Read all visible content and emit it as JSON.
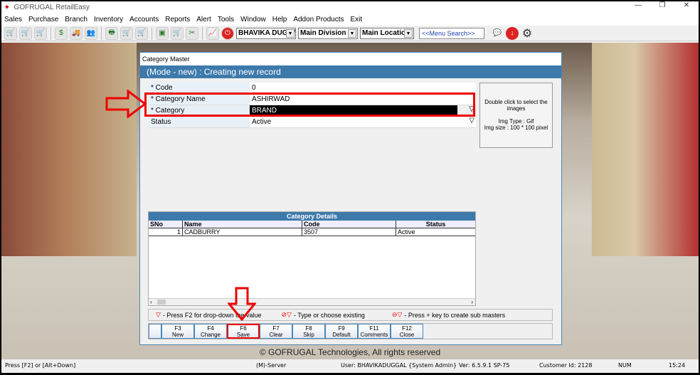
{
  "app": {
    "title": "GOFRUGAL RetailEasy"
  },
  "menu": [
    "Sales",
    "Purchase",
    "Branch",
    "Inventory",
    "Accounts",
    "Reports",
    "Alert",
    "Tools",
    "Window",
    "Help",
    "Addon Products",
    "Exit"
  ],
  "toolbar": {
    "user_select": "BHAVIKA DUGG/",
    "division_select": "Main Division",
    "location_select": "Main Location",
    "search_placeholder": "<<Menu Search>>"
  },
  "dialog": {
    "title": "Category Master",
    "mode": "(Mode - new) : Creating new record",
    "fields": [
      {
        "label": "* Code",
        "value": "0"
      },
      {
        "label": "* Category Name",
        "value": "ASHIRWAD"
      },
      {
        "label": "* Category",
        "value": "BRAND"
      },
      {
        "label": "Status",
        "value": "Active"
      }
    ],
    "image_box": {
      "hint": "Double click to select the images",
      "type": "Img Type : Gif",
      "size": "Img size : 100 * 100 pixel"
    },
    "grid": {
      "title": "Category Details",
      "columns": [
        "SNo",
        "Name",
        "Code",
        "Status"
      ],
      "rows": [
        [
          "1",
          "CADBURRY",
          "3507",
          "Active"
        ]
      ]
    },
    "legend": [
      "- Press F2 for drop-down the value",
      "- Type or choose existing",
      "- Press + key to create sub masters"
    ],
    "buttons": [
      {
        "key": "F3",
        "label": "New"
      },
      {
        "key": "F4",
        "label": "Change"
      },
      {
        "key": "F6",
        "label": "Save"
      },
      {
        "key": "F7",
        "label": "Clear"
      },
      {
        "key": "F8",
        "label": "Skip"
      },
      {
        "key": "F9",
        "label": "Default"
      },
      {
        "key": "F11",
        "label": "Comments"
      },
      {
        "key": "F12",
        "label": "Close"
      }
    ]
  },
  "copyright": "© GOFRUGAL Technologies, All rights reserved",
  "statusbar": {
    "hint": "Press [F2] or [Alt+Down]",
    "server": "(M)-Server",
    "user": "User: BHAVIKADUGGAL {System Admin}",
    "version": "Ver: 6.5.9.1 SP-75",
    "customer": "Customer Id: 2128",
    "num": "NUM",
    "time": "15:24"
  }
}
